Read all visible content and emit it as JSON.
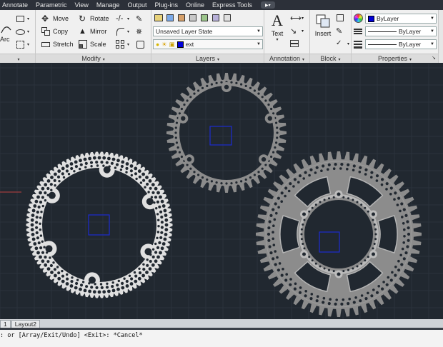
{
  "menu": [
    "Annotate",
    "Parametric",
    "View",
    "Manage",
    "Output",
    "Plug-ins",
    "Online",
    "Express Tools"
  ],
  "menu_extra_icon": "video-icon",
  "draw_panel": {
    "arc_label": "Arc"
  },
  "modify": {
    "title": "Modify",
    "move": "Move",
    "rotate": "Rotate",
    "copy": "Copy",
    "mirror": "Mirror",
    "stretch": "Stretch",
    "scale": "Scale"
  },
  "layers": {
    "title": "Layers",
    "layer_state": "Unsaved Layer State",
    "current_layer": "ext",
    "current_layer_color": "#0000d8"
  },
  "annotation": {
    "title": "Annotation",
    "text_label": "Text"
  },
  "block": {
    "title": "Block",
    "insert_label": "Insert"
  },
  "properties": {
    "title": "Properties",
    "color": "ByLayer",
    "linetype": "ByLayer",
    "lineweight": "ByLayer"
  },
  "layout_tabs": [
    "1",
    "Layout2"
  ],
  "command_line": ": or [Array/Exit/Undo] <Exit>: *Cancel*",
  "colors": {
    "canvas_bg": "#212830",
    "gear_fill": "#8c8c8c",
    "white_gear_fill": "#e0e0e0",
    "selection_box": "#1c2bd0"
  }
}
